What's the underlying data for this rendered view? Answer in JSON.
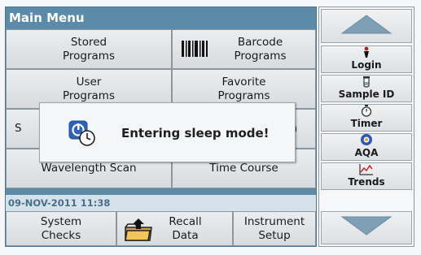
{
  "title": "Main Menu",
  "buttons": {
    "stored_programs": "Stored\nPrograms",
    "barcode_programs": "Barcode\nPrograms",
    "user_programs": "User\nPrograms",
    "favorite_programs": "Favorite\nPrograms",
    "row3_left_partial": "S",
    "row3_right_partial": "h",
    "wavelength_scan": "Wavelength Scan",
    "time_course": "Time Course",
    "system_checks": "System\nChecks",
    "recall_data": "Recall\nData",
    "instrument_setup": "Instrument\nSetup"
  },
  "status": {
    "datetime": "09-NOV-2011  11:38"
  },
  "side": {
    "login": "Login",
    "sample_id": "Sample ID",
    "timer": "Timer",
    "aqa": "AQA",
    "trends": "Trends"
  },
  "dialog": {
    "message": "Entering sleep mode!"
  },
  "icons": {
    "barcode": "barcode-icon",
    "folder": "folder-up-icon",
    "sleep": "sleep-clock-icon",
    "login": "person-icon",
    "sample_id": "sample-vial-icon",
    "timer": "stopwatch-icon",
    "aqa": "aqa-icon",
    "trends": "trend-graph-icon",
    "scroll_up": "arrow-up-icon",
    "scroll_down": "arrow-down-icon"
  },
  "colors": {
    "title_bar": "#5b8ba8",
    "arrow": "#7f9fb7",
    "status_text": "#4a6e8a"
  }
}
